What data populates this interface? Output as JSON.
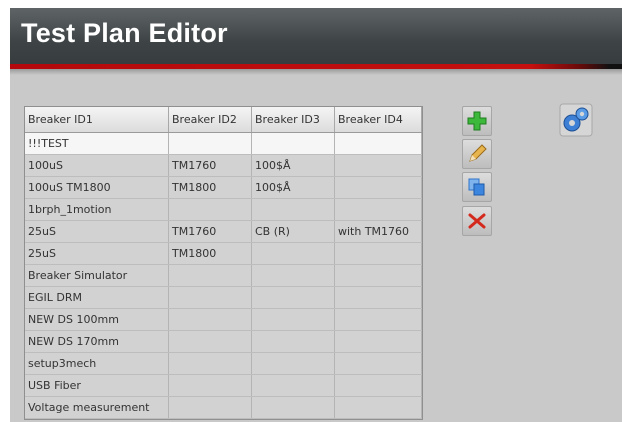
{
  "window": {
    "title": "Test Plan Editor"
  },
  "table": {
    "columns": [
      "Breaker ID1",
      "Breaker ID2",
      "Breaker ID3",
      "Breaker ID4"
    ],
    "rows": [
      [
        "!!!TEST",
        "",
        "",
        ""
      ],
      [
        "100uS",
        "TM1760",
        "100$Å",
        ""
      ],
      [
        "100uS TM1800",
        "TM1800",
        "100$Å",
        ""
      ],
      [
        "1brph_1motion",
        "",
        "",
        ""
      ],
      [
        "25uS",
        "TM1760",
        "CB (R)",
        "with TM1760"
      ],
      [
        "25uS",
        "TM1800",
        "",
        ""
      ],
      [
        "Breaker Simulator",
        "",
        "",
        ""
      ],
      [
        "EGIL DRM",
        "",
        "",
        ""
      ],
      [
        "NEW DS 100mm",
        "",
        "",
        ""
      ],
      [
        "NEW DS 170mm",
        "",
        "",
        ""
      ],
      [
        "setup3mech",
        "",
        "",
        ""
      ],
      [
        "USB Fiber",
        "",
        "",
        ""
      ],
      [
        "Voltage measurement",
        "",
        "",
        ""
      ]
    ],
    "selected_row": 0
  },
  "toolbar": {
    "buttons": [
      {
        "icon": "add-icon",
        "color": "#3cb83a"
      },
      {
        "icon": "edit-pencil-icon",
        "color": "#d9a441"
      },
      {
        "icon": "copy-icon",
        "color": "#2f74c9"
      },
      {
        "icon": "delete-icon",
        "color": "#d42a1e"
      }
    ],
    "config_icon": "settings-gears-icon"
  },
  "colors": {
    "title_bar": "#3e4446",
    "accent_red": "#c5100f"
  }
}
